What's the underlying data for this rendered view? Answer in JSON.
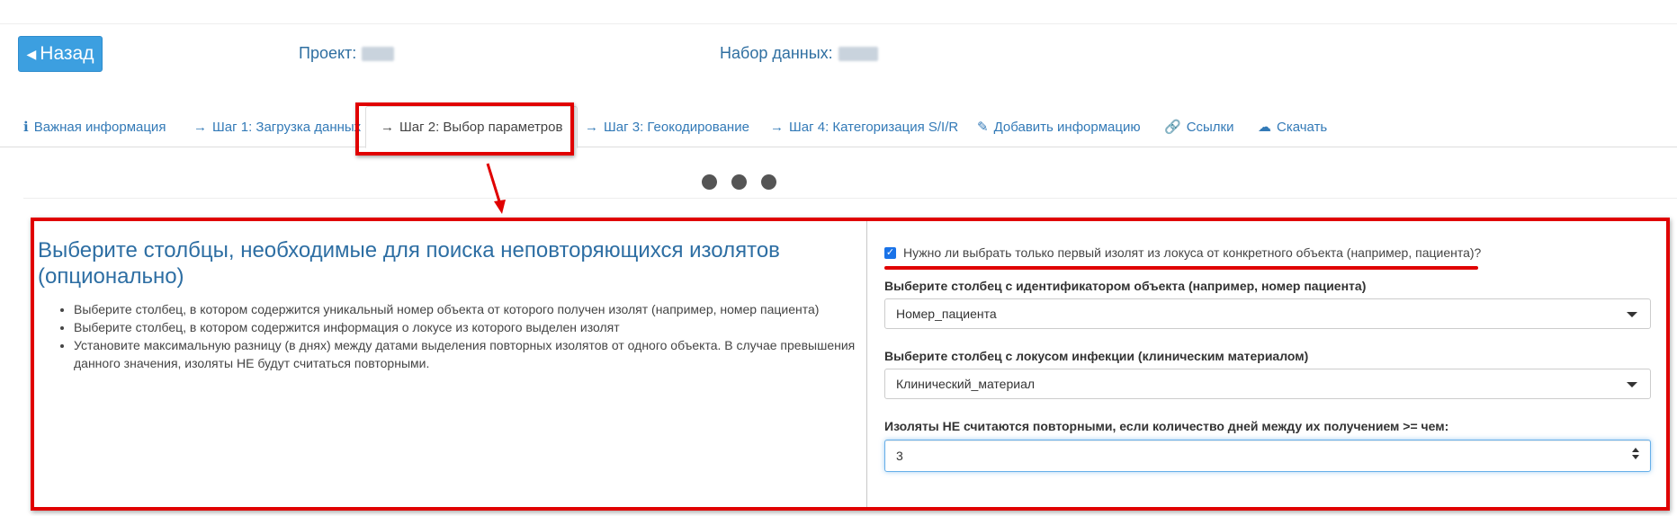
{
  "header": {
    "back_label": "Назад",
    "project_label": "Проект:",
    "dataset_label": "Набор данных:"
  },
  "tabs": [
    {
      "label": "Важная информация",
      "icon": "info-icon"
    },
    {
      "label": "Шаг 1: Загрузка данных",
      "icon": "arrow-right-icon"
    },
    {
      "label": "Шаг 2: Выбор параметров",
      "icon": "arrow-right-icon",
      "active": true
    },
    {
      "label": "Шаг 3: Геокодирование",
      "icon": "arrow-right-icon"
    },
    {
      "label": "Шаг 4: Категоризация S/I/R",
      "icon": "arrow-right-icon"
    },
    {
      "label": "Добавить информацию",
      "icon": "edit-icon"
    },
    {
      "label": "Ссылки",
      "icon": "link-icon"
    },
    {
      "label": "Скачать",
      "icon": "cloud-download-icon"
    }
  ],
  "left": {
    "title": "Выберите столбцы, необходимые для поиска неповторяющихся изолятов (опционально)",
    "bullets": [
      "Выберите столбец, в котором содержится уникальный номер объекта от которого получен изолят (например, номер пациента)",
      "Выберите столбец, в котором содержится информация о локусе из которого выделен изолят",
      "Установите максимальную разницу (в днях) между датами выделения повторных изолятов от одного объекта. В случае превышения данного значения, изоляты НЕ будут считаться повторными."
    ]
  },
  "right": {
    "checkbox_label": "Нужно ли выбрать только первый изолят из локуса от конкретного объекта (например, пациента)?",
    "checkbox_checked": true,
    "object_label": "Выберите столбец с идентификатором объекта (например, номер пациента)",
    "object_value": "Номер_пациента",
    "locus_label": "Выберите столбец с локусом инфекции (клиническим материалом)",
    "locus_value": "Клинический_материал",
    "days_label": "Изоляты НЕ считаются повторными, если количество дней между их получением >= чем:",
    "days_value": "3"
  },
  "colors": {
    "accent": "#3c9fe0",
    "link": "#337ab7",
    "highlight": "#e00000"
  }
}
